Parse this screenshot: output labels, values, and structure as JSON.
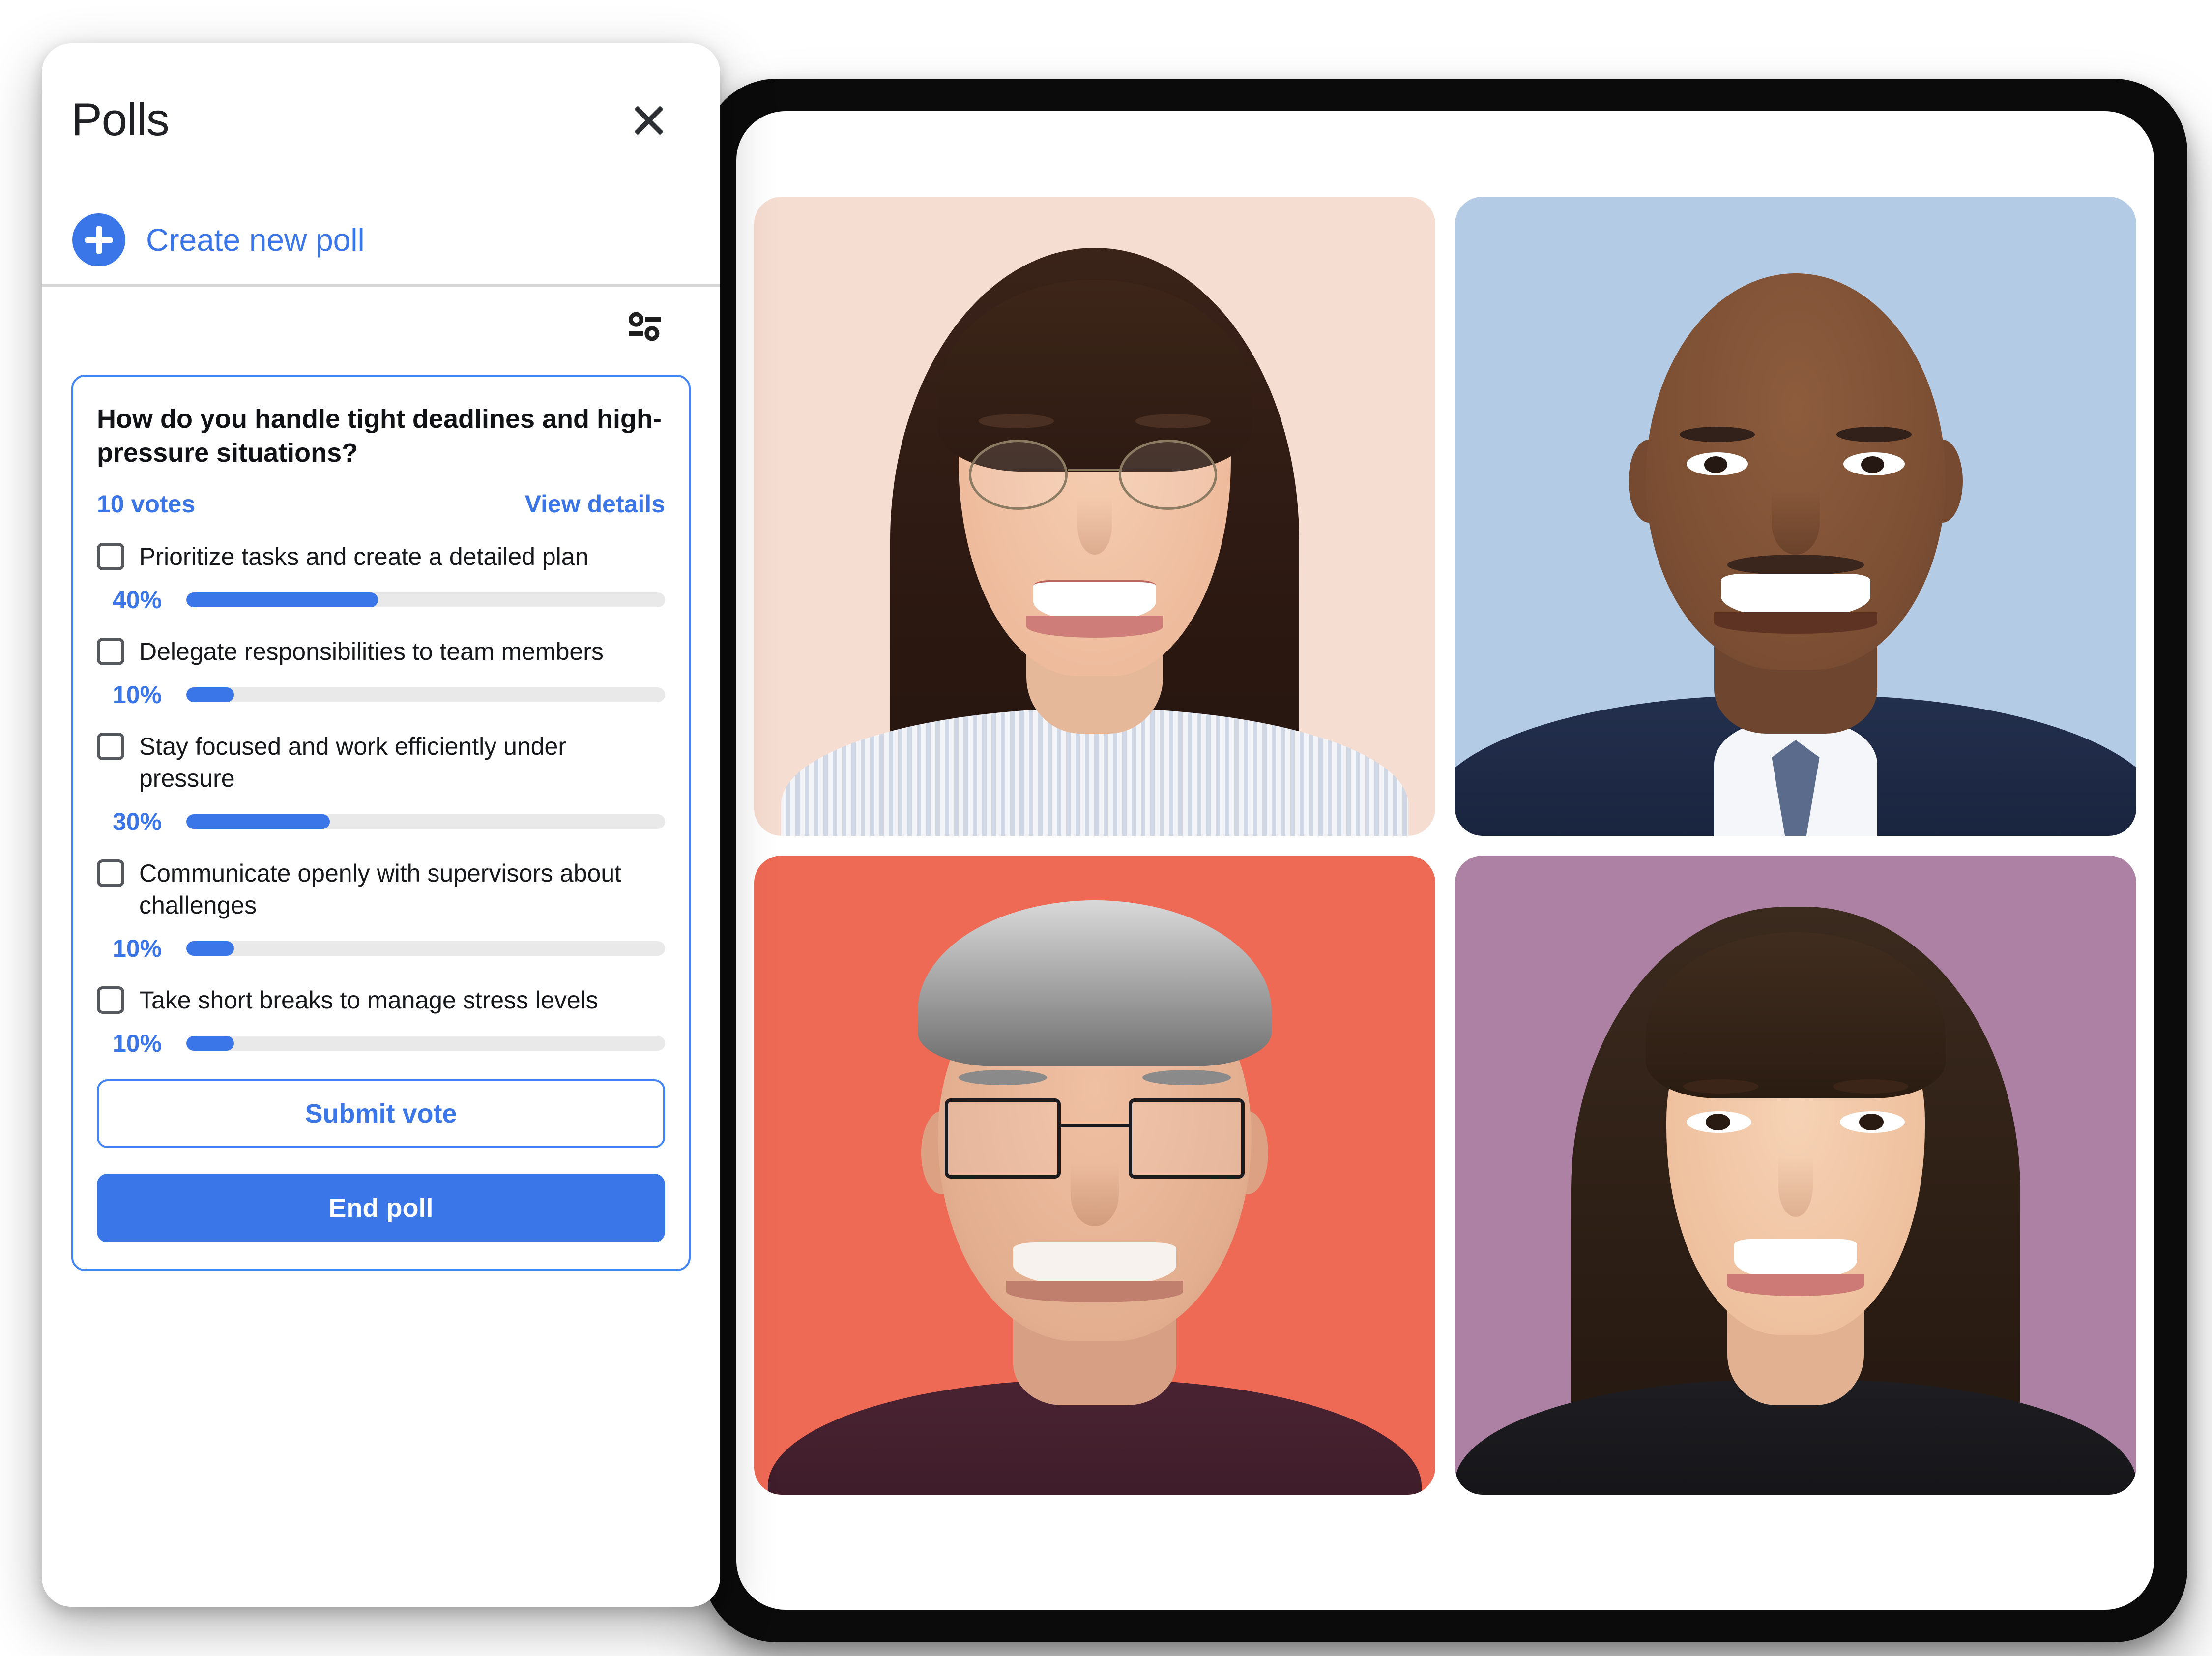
{
  "panel": {
    "title": "Polls",
    "close_icon": "close-icon",
    "create_new_poll_label": "Create new poll",
    "plus_icon": "plus-icon",
    "tune_icon": "tune-icon"
  },
  "poll": {
    "question": "How do you handle tight deadlines and high-pressure situations?",
    "votes_text": "10 votes",
    "view_details_label": "View details",
    "options": [
      {
        "label": "Prioritize tasks and create a detailed plan",
        "percent_text": "40%",
        "percent": 40
      },
      {
        "label": "Delegate responsibilities to team members",
        "percent_text": "10%",
        "percent": 10
      },
      {
        "label": "Stay focused and work efficiently under pressure",
        "percent_text": "30%",
        "percent": 30
      },
      {
        "label": "Communicate openly with supervisors about challenges",
        "percent_text": "10%",
        "percent": 10
      },
      {
        "label": "Take short breaks to manage stress levels",
        "percent_text": "10%",
        "percent": 10
      }
    ],
    "submit_label": "Submit vote",
    "end_poll_label": "End poll"
  },
  "video_grid": {
    "tiles": [
      {
        "name": "participant-tile-1",
        "background_color": "#f6ddd1"
      },
      {
        "name": "participant-tile-2",
        "background_color": "#b3cbe5"
      },
      {
        "name": "participant-tile-3",
        "background_color": "#ef6a55"
      },
      {
        "name": "participant-tile-4",
        "background_color": "#ad81a4"
      }
    ]
  },
  "colors": {
    "accent_blue": "#3b76e8",
    "card_border_blue": "#4285f4",
    "track_gray": "#e9e9e9",
    "divider_gray": "#d9d9d9",
    "device_frame": "#0b0b0c"
  }
}
